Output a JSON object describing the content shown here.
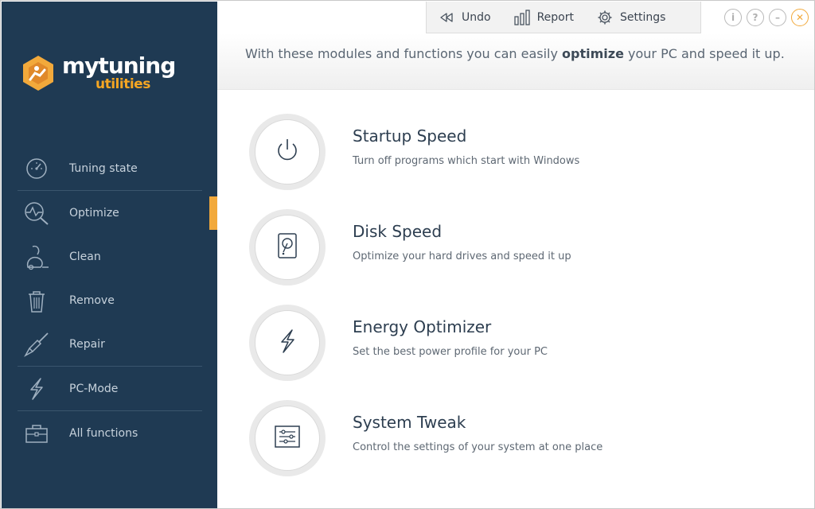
{
  "app": {
    "logo_line1": "mytuning",
    "logo_line2": "utilities",
    "accent_color": "#f2a93b",
    "sidebar_color": "#1f3a53"
  },
  "toolbar": {
    "undo_label": "Undo",
    "report_label": "Report",
    "settings_label": "Settings"
  },
  "window_controls": {
    "info": "i",
    "help": "?",
    "minimize": "–",
    "close": "✕"
  },
  "sidebar": {
    "active_item": "Optimize",
    "items": [
      {
        "label": "Tuning state",
        "icon": "speedometer-icon"
      },
      {
        "label": "Optimize",
        "icon": "magnifier-pulse-icon"
      },
      {
        "label": "Clean",
        "icon": "vacuum-icon"
      },
      {
        "label": "Remove",
        "icon": "trash-icon"
      },
      {
        "label": "Repair",
        "icon": "screwdriver-icon"
      },
      {
        "label": "PC-Mode",
        "icon": "lightning-icon"
      },
      {
        "label": "All functions",
        "icon": "toolbox-icon"
      }
    ]
  },
  "header": {
    "text_before": "With these modules and functions you can easily ",
    "text_bold": "optimize",
    "text_after": " your PC and speed it up."
  },
  "modules": [
    {
      "title": "Startup Speed",
      "description": "Turn off programs which start with Windows",
      "icon": "power-icon"
    },
    {
      "title": "Disk Speed",
      "description": "Optimize your hard drives and speed it up",
      "icon": "hard-drive-icon"
    },
    {
      "title": "Energy Optimizer",
      "description": "Set the best power profile for your PC",
      "icon": "lightning-icon"
    },
    {
      "title": "System Tweak",
      "description": "Control the settings of your system at one place",
      "icon": "sliders-icon"
    }
  ]
}
